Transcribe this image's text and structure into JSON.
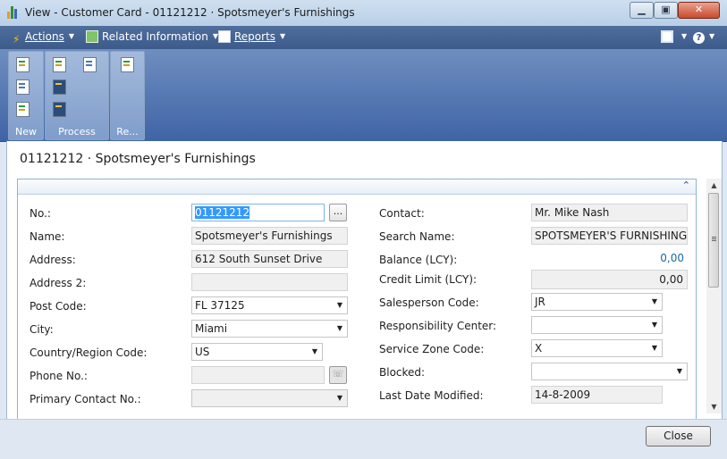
{
  "window": {
    "title": "View - Customer Card - 01121212 · Spotsmeyer's Furnishings",
    "minimize": "▁",
    "restore": "▣",
    "close": "✕"
  },
  "commandbar": {
    "actions": "Actions",
    "related": "Related Information",
    "reports": "Reports",
    "help": "?"
  },
  "ribbon": {
    "groups": [
      "New",
      "Process",
      "Re..."
    ]
  },
  "card": {
    "title": "01121212 · Spotsmeyer's Furnishings",
    "collapse_glyph": "⌃",
    "left": [
      {
        "label": "No.:",
        "value": "01121212",
        "assist": "..."
      },
      {
        "label": "Name:",
        "value": "Spotsmeyer's Furnishings"
      },
      {
        "label": "Address:",
        "value": "612 South Sunset Drive"
      },
      {
        "label": "Address 2:",
        "value": ""
      },
      {
        "label": "Post Code:",
        "value": "FL 37125"
      },
      {
        "label": "City:",
        "value": "Miami"
      },
      {
        "label": "Country/Region Code:",
        "value": "US"
      },
      {
        "label": "Phone No.:",
        "value": ""
      },
      {
        "label": "Primary Contact No.:",
        "value": ""
      }
    ],
    "right": [
      {
        "label": "Contact:",
        "value": "Mr. Mike Nash"
      },
      {
        "label": "Search Name:",
        "value": "SPOTSMEYER'S FURNISHINGS"
      },
      {
        "label": "Balance (LCY):",
        "value": "0,00"
      },
      {
        "label": "Credit Limit (LCY):",
        "value": "0,00"
      },
      {
        "label": "Salesperson Code:",
        "value": "JR"
      },
      {
        "label": "Responsibility Center:",
        "value": ""
      },
      {
        "label": "Service Zone Code:",
        "value": "X"
      },
      {
        "label": "Blocked:",
        "value": ""
      },
      {
        "label": "Last Date Modified:",
        "value": "14-8-2009"
      }
    ]
  },
  "footer": {
    "close": "Close"
  }
}
